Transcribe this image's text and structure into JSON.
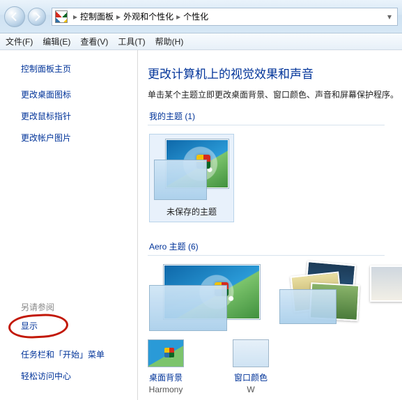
{
  "breadcrumb": {
    "root": "控制面板",
    "mid": "外观和个性化",
    "leaf": "个性化"
  },
  "menus": {
    "file": "文件(F)",
    "edit": "编辑(E)",
    "view": "查看(V)",
    "tools": "工具(T)",
    "help": "帮助(H)"
  },
  "sidebar": {
    "home": "控制面板主页",
    "links": {
      "desktop_icons": "更改桌面图标",
      "mouse_pointers": "更改鼠标指针",
      "account_picture": "更改帐户图片"
    },
    "see_also_head": "另请参阅",
    "see_also": {
      "display": "显示",
      "taskbar": "任务栏和「开始」菜单",
      "ease": "轻松访问中心"
    }
  },
  "main": {
    "title": "更改计算机上的视觉效果和声音",
    "subtitle": "单击某个主题立即更改桌面背景、窗口颜色、声音和屏幕保护程序。",
    "my_themes_head": "我的主题 (1)",
    "unsaved_theme": "未保存的主题",
    "aero_head": "Aero 主题 (6)"
  },
  "controls": {
    "desktop_bg": "桌面背景",
    "desktop_bg_val": "Harmony",
    "window_color": "窗口颜色",
    "window_color_val_prefix": "W"
  }
}
